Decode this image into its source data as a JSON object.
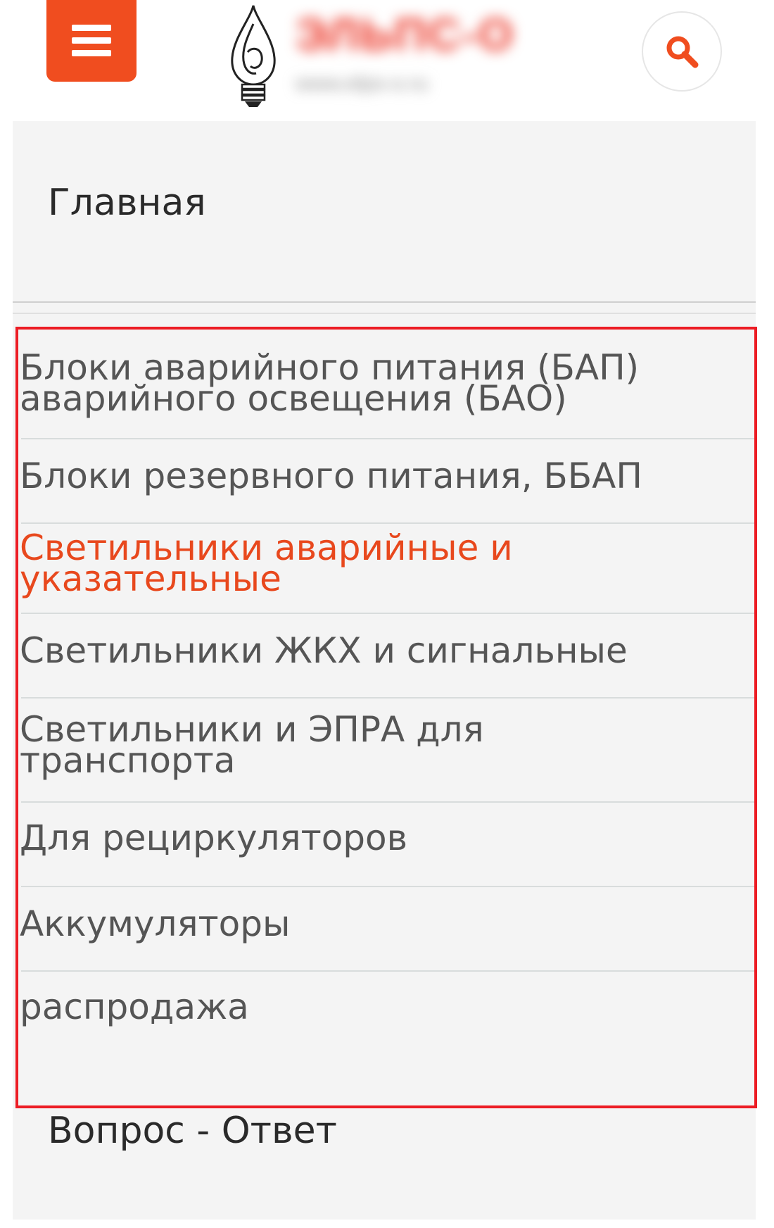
{
  "header": {
    "menu_icon": "hamburger-menu-icon",
    "logo_icon": "lightbulb-flame-logo-icon",
    "brand_name": "ЭЛЬПС-О",
    "brand_site": "www.elps-o.ru",
    "search_icon": "magnifier-icon",
    "accent_color": "#f04d1f"
  },
  "nav": {
    "home": "Главная",
    "categories": [
      {
        "line1": "Блоки аварийного питания (БАП)",
        "line2": "аварийного освещения (БАО)",
        "active": false
      },
      {
        "line1": "Блоки резервного питания, ББАП",
        "line2": "",
        "active": false
      },
      {
        "line1": "Светильники аварийные и",
        "line2": "указательные",
        "active": true
      },
      {
        "line1": "Светильники ЖКХ и сигнальные",
        "line2": "",
        "active": false
      },
      {
        "line1": "Светильники и ЭПРА для",
        "line2": "транспорта",
        "active": false
      },
      {
        "line1": "Для рециркуляторов",
        "line2": "",
        "active": false
      },
      {
        "line1": "Аккумуляторы",
        "line2": "",
        "active": false
      },
      {
        "line1": "распродажа",
        "line2": "",
        "active": false
      }
    ],
    "faq": "Вопрос - Ответ",
    "active_color": "#e8481d",
    "highlight_color": "#ec1c24"
  }
}
